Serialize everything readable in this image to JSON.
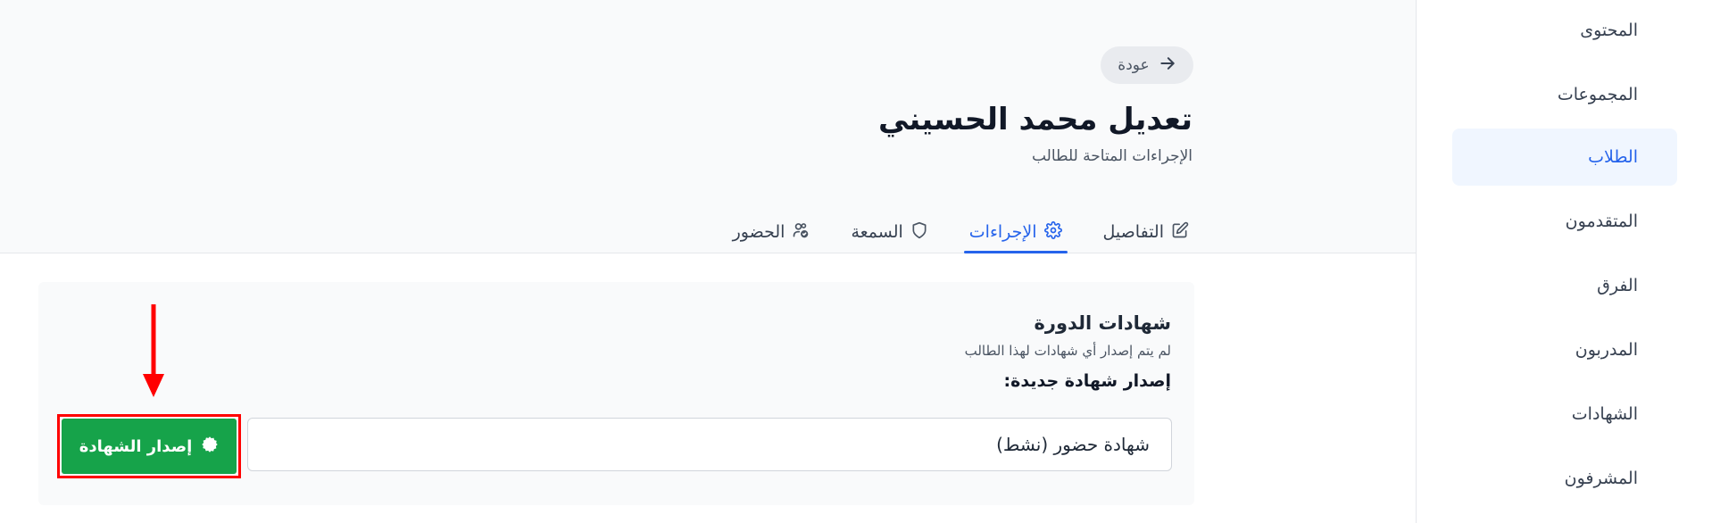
{
  "sidebar": {
    "items": [
      {
        "label": "المحتوى",
        "active": false
      },
      {
        "label": "المجموعات",
        "active": false
      },
      {
        "label": "الطلاب",
        "active": true
      },
      {
        "label": "المتقدمون",
        "active": false
      },
      {
        "label": "الفرق",
        "active": false
      },
      {
        "label": "المدربون",
        "active": false
      },
      {
        "label": "الشهادات",
        "active": false
      },
      {
        "label": "المشرفون",
        "active": false
      }
    ]
  },
  "header": {
    "back_label": "عودة",
    "title": "تعديل محمد الحسيني",
    "subtitle": "الإجراءات المتاحة للطالب"
  },
  "tabs": [
    {
      "label": "التفاصيل",
      "icon": "edit-icon",
      "active": false
    },
    {
      "label": "الإجراءات",
      "icon": "gear-icon",
      "active": true
    },
    {
      "label": "السمعة",
      "icon": "shield-icon",
      "active": false
    },
    {
      "label": "الحضور",
      "icon": "users-check-icon",
      "active": false
    }
  ],
  "certificates": {
    "title": "شهادات الدورة",
    "note": "لم يتم إصدار أي شهادات لهذا الطالب",
    "new_label": "إصدار شهادة جديدة:",
    "selected_option": "شهادة حضور (نشط)",
    "issue_button": "إصدار الشهادة"
  },
  "colors": {
    "accent": "#2563eb",
    "issue_button": "#16a34a",
    "highlight": "#ff0000"
  }
}
